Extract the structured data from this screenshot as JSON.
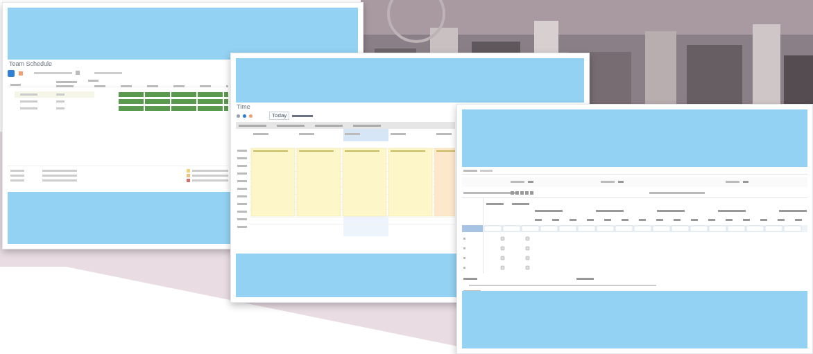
{
  "screens": [
    {
      "kind": "schedule",
      "title": "Team Schedule"
    },
    {
      "kind": "calendar",
      "title": "Time",
      "today_button": "Today"
    },
    {
      "kind": "grid"
    }
  ]
}
